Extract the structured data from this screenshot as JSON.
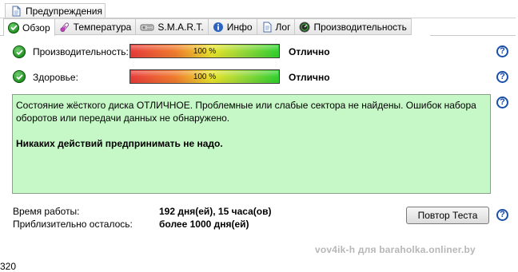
{
  "top_tab": {
    "label": "Предупреждения",
    "icon": "document-icon"
  },
  "tabs": [
    {
      "label": "Обзор",
      "icon": "check-icon",
      "active": true
    },
    {
      "label": "Температура",
      "icon": "thermometer-icon"
    },
    {
      "label": "S.M.A.R.T.",
      "icon": "hdd-icon"
    },
    {
      "label": "Инфо",
      "icon": "info-icon"
    },
    {
      "label": "Лог",
      "icon": "log-icon"
    },
    {
      "label": "Производительность",
      "icon": "gauge-icon"
    }
  ],
  "performance": {
    "label": "Производительность:",
    "percent_text": "100 %",
    "percent": 100,
    "status": "Отлично"
  },
  "health": {
    "label": "Здоровье:",
    "percent_text": "100 %",
    "percent": 100,
    "status": "Отлично"
  },
  "summary": {
    "text": "Состояние жёсткого диска ОТЛИЧНОЕ. Проблемные или слабые сектора не найдены. Ошибок набора оборотов или передачи данных не обнаружено.",
    "action": "Никаких действий предпринимать не надо."
  },
  "uptime": {
    "label": "Время работы:",
    "value": "192 дня(ей), 15 часа(ов)"
  },
  "remaining": {
    "label": "Приблизительно осталось:",
    "value": "более 1000 дня(ей)"
  },
  "retest_button": "Повтор Теста",
  "help_glyph": "?",
  "watermark": "vov4ik-h для baraholka.onliner.by",
  "corner_number": "320",
  "colors": {
    "box_bg": "#c6f7c6",
    "help_blue": "#1c4fa8",
    "check_green": "#1f8a1f"
  }
}
